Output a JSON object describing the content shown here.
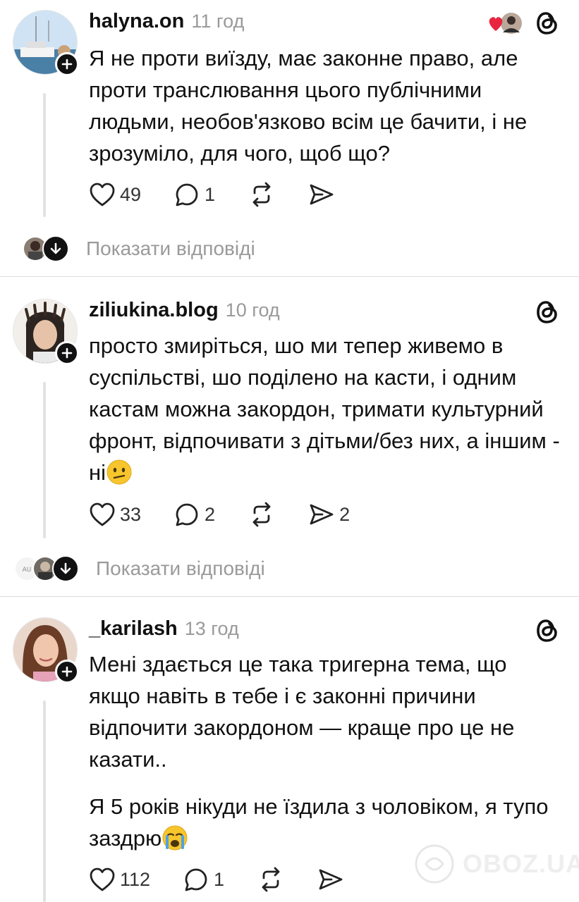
{
  "posts": [
    {
      "username": "halyna.on",
      "time": "11 год",
      "paragraphs": [
        "Я не проти виїзду, має законне право, але проти транслювання цього публічними людьми,  необов'язково всім це бачити, і не зрозуміло, для чого, щоб що?"
      ],
      "likes": "49",
      "comments": "1",
      "reposts": "",
      "shares": "",
      "show_replies": "Показати відповіді"
    },
    {
      "username": "ziliukina.blog",
      "time": "10 год",
      "paragraphs": [
        "просто змиріться, шо ми тепер живемо в суспільстві, шо поділено на касти, і одним кастам можна закордон, тримати культурний фронт, відпочивати з дітьми/без них, а іншим - ні"
      ],
      "likes": "33",
      "comments": "2",
      "reposts": "",
      "shares": "2",
      "show_replies": "Показати відповіді"
    },
    {
      "username": "_karilash",
      "time": "13 год",
      "paragraphs": [
        "Мені здається це така тригерна тема, що якщо навіть в тебе і є законні причини відпочити закордоном — краще про це не казати..",
        "Я 5 років нікуди не їздила з чоловіком, я тупо заздрю"
      ],
      "likes": "112",
      "comments": "1",
      "reposts": "",
      "shares": ""
    }
  ],
  "watermark": "OBOZ.UA",
  "icons": {
    "threads": "threads-logo-icon",
    "like": "heart-outline-icon",
    "comment": "comment-bubble-icon",
    "repost": "repost-arrows-icon",
    "share": "send-arrow-icon",
    "follow": "plus-icon",
    "expand": "arrow-down-icon"
  },
  "colors": {
    "text": "#111111",
    "muted": "#9a9a9a",
    "liked_heart": "#e8263f"
  }
}
